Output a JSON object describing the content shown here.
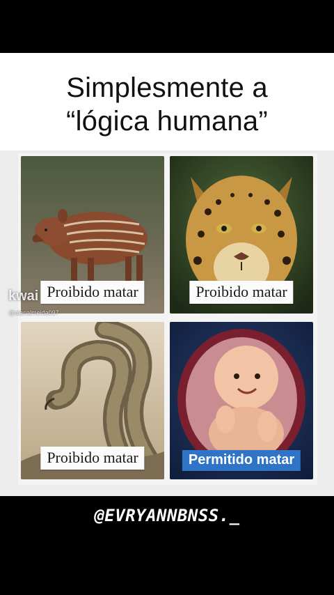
{
  "title": {
    "line1": "Simplesmente a",
    "line2": "“lógica humana”"
  },
  "panels": [
    {
      "subject": "tapir-calf",
      "caption": "Proibido matar",
      "caption_style": "white"
    },
    {
      "subject": "jaguar",
      "caption": "Proibido matar",
      "caption_style": "white"
    },
    {
      "subject": "rattlesnake",
      "caption": "Proibido matar",
      "caption_style": "white"
    },
    {
      "subject": "baby-in-womb",
      "caption": "Permitido matar",
      "caption_style": "blue"
    }
  ],
  "watermark": {
    "app": "kwai",
    "handle": "@alanalmeida097"
  },
  "signature": "@EVRYANNBNSS._",
  "colors": {
    "background": "#000000",
    "title_band": "#ffffff",
    "blue_caption": "#2f74c7"
  }
}
